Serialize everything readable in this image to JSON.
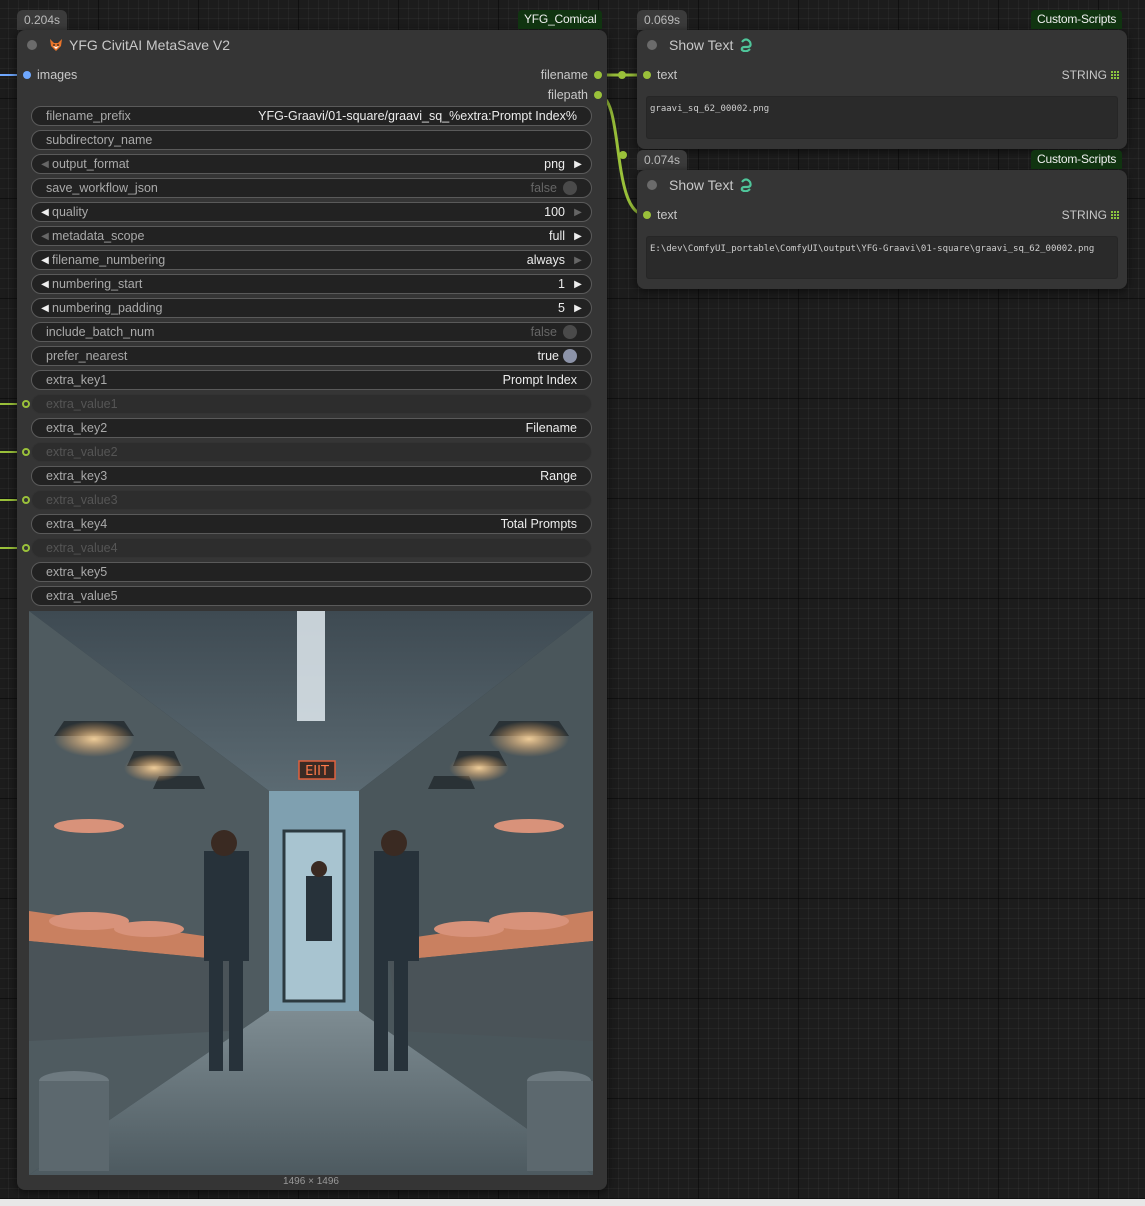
{
  "main_node": {
    "time": "0.204s",
    "pack": "YFG_Comical",
    "title": "YFG CivitAI MetaSave V2",
    "inputs": [
      {
        "label": "images"
      }
    ],
    "outputs": [
      {
        "label": "filename"
      },
      {
        "label": "filepath"
      }
    ],
    "widgets": [
      {
        "name": "filename_prefix",
        "value": "YFG-Graavi/01-square/graavi_sq_%extra:Prompt Index%"
      },
      {
        "name": "subdirectory_name",
        "value": ""
      },
      {
        "name": "output_format",
        "value": "png"
      },
      {
        "name": "save_workflow_json",
        "value": "false"
      },
      {
        "name": "quality",
        "value": "100"
      },
      {
        "name": "metadata_scope",
        "value": "full"
      },
      {
        "name": "filename_numbering",
        "value": "always"
      },
      {
        "name": "numbering_start",
        "value": "1"
      },
      {
        "name": "numbering_padding",
        "value": "5"
      },
      {
        "name": "include_batch_num",
        "value": "false"
      },
      {
        "name": "prefer_nearest",
        "value": "true"
      },
      {
        "name": "extra_key1",
        "value": "Prompt Index"
      },
      {
        "name": "extra_value1",
        "value": ""
      },
      {
        "name": "extra_key2",
        "value": "Filename"
      },
      {
        "name": "extra_value2",
        "value": ""
      },
      {
        "name": "extra_key3",
        "value": "Range"
      },
      {
        "name": "extra_value3",
        "value": ""
      },
      {
        "name": "extra_key4",
        "value": "Total Prompts"
      },
      {
        "name": "extra_value4",
        "value": ""
      },
      {
        "name": "extra_key5",
        "value": ""
      },
      {
        "name": "extra_value5",
        "value": ""
      }
    ],
    "preview": {
      "size_label": "1496 × 1496"
    }
  },
  "show_text_1": {
    "time": "0.069s",
    "pack": "Custom-Scripts",
    "title": "Show Text",
    "input_label": "text",
    "output_type": "STRING",
    "text": "graavi_sq_62_00002.png"
  },
  "show_text_2": {
    "time": "0.074s",
    "pack": "Custom-Scripts",
    "title": "Show Text",
    "input_label": "text",
    "output_type": "STRING",
    "text": "E:\\dev\\ComfyUI_portable\\ComfyUI\\output\\YFG-Graavi\\01-square\\graavi_sq_62_00002.png"
  },
  "colors": {
    "image_slot": "#6fa8ff",
    "string_wire": "#9ac13a",
    "pack_badge": "#103410",
    "node_bg": "#353535"
  },
  "icons": {
    "title_icon": "fox-icon",
    "show_text_icon": "python-snake-icon"
  }
}
